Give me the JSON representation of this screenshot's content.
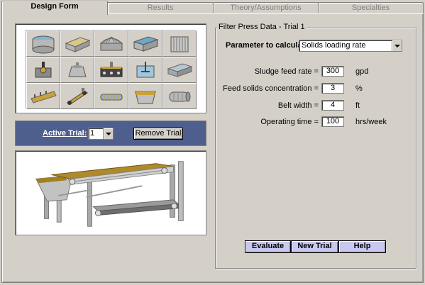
{
  "tabs": [
    {
      "label": "Design Form",
      "active": true
    },
    {
      "label": "Results",
      "active": false
    },
    {
      "label": "Theory/Assumptions",
      "active": false
    },
    {
      "label": "Specialties",
      "active": false
    }
  ],
  "process_icons": [
    "circular-clarifier-icon",
    "rectangular-tank-icon",
    "dome-digester-icon",
    "flotation-tank-icon",
    "vertical-plate-icon",
    "rotary-drum-filter-icon",
    "centrifuge-icon",
    "belt-thickener-icon",
    "mixer-tank-icon",
    "drying-bed-icon",
    "lagoon-icon",
    "belt-filter-press-icon",
    "screw-press-icon",
    "sludge-bin-icon",
    "rotary-dryer-icon"
  ],
  "trial": {
    "label": "Active Trial:",
    "selected": "1",
    "remove_label": "Remove Trial"
  },
  "illustration": "belt-filter-press-illustration",
  "form": {
    "group_title": "Filter Press Data - Trial 1",
    "param_label": "Parameter to calculate:",
    "param_value": "Solids loading rate",
    "fields": [
      {
        "label": "Sludge feed rate =",
        "value": "300",
        "unit": "gpd"
      },
      {
        "label": "Feed solids concentration =",
        "value": "3",
        "unit": "%"
      },
      {
        "label": "Belt width =",
        "value": "4",
        "unit": "ft"
      },
      {
        "label": "Operating time =",
        "value": "100",
        "unit": "hrs/week"
      }
    ]
  },
  "buttons": {
    "evaluate": "Evaluate",
    "new_trial": "New Trial",
    "help": "Help"
  },
  "colors": {
    "window_bg": "#d4d0c8",
    "trial_bar": "#4f5f8d",
    "action_button": "#c8c8f0",
    "belt": "#b08a2a"
  }
}
